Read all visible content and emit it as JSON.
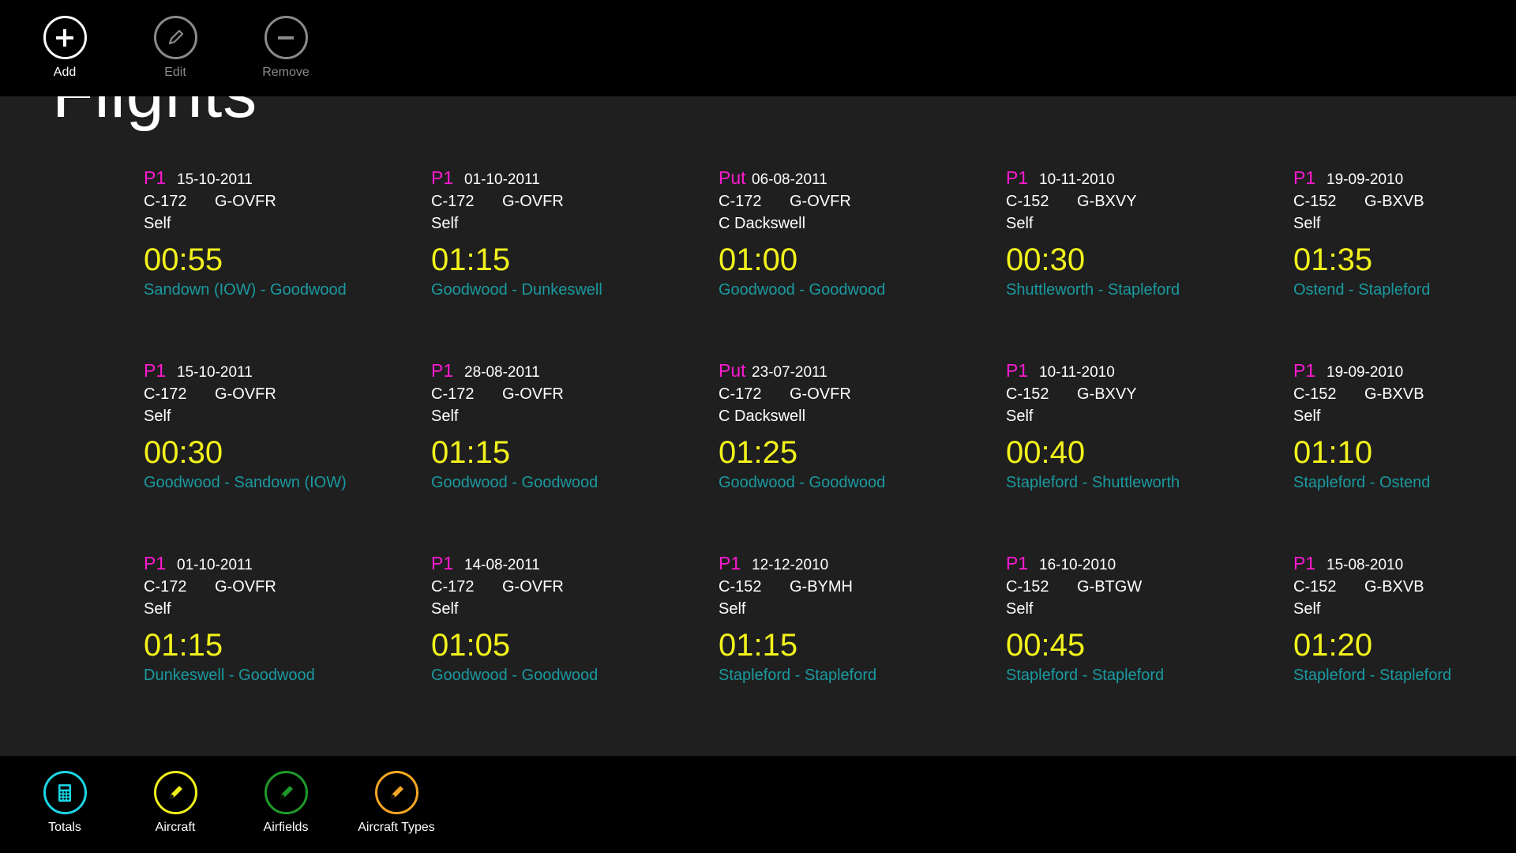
{
  "page": {
    "title": "Flights"
  },
  "top_bar": {
    "buttons": [
      {
        "label": "Add",
        "icon": "plus-icon",
        "enabled": true
      },
      {
        "label": "Edit",
        "icon": "pencil-icon",
        "enabled": false
      },
      {
        "label": "Remove",
        "icon": "minus-icon",
        "enabled": false
      }
    ]
  },
  "bottom_bar": {
    "buttons": [
      {
        "label": "Totals",
        "icon": "calculator-icon",
        "color": "#1ad6e6"
      },
      {
        "label": "Aircraft",
        "icon": "pencil-icon",
        "color": "#f2f21c"
      },
      {
        "label": "Airfields",
        "icon": "pencil-icon",
        "color": "#1f9a2a"
      },
      {
        "label": "Aircraft Types",
        "icon": "pencil-icon",
        "color": "#f5a623"
      }
    ]
  },
  "colors": {
    "role": "#ff1ad0",
    "duration": "#f2f21c",
    "route": "#1a9aa0",
    "background": "#1f1f1f",
    "appbar": "#000000"
  },
  "flights": [
    {
      "role": "P1",
      "date": "15-10-2011",
      "type": "C-172",
      "reg": "G-OVFR",
      "pic": "Self",
      "duration": "00:55",
      "route": "Sandown (IOW) - Goodwood"
    },
    {
      "role": "P1",
      "date": "01-10-2011",
      "type": "C-172",
      "reg": "G-OVFR",
      "pic": "Self",
      "duration": "01:15",
      "route": "Goodwood - Dunkeswell"
    },
    {
      "role": "Put",
      "date": "06-08-2011",
      "type": "C-172",
      "reg": "G-OVFR",
      "pic": "C Dackswell",
      "duration": "01:00",
      "route": "Goodwood - Goodwood"
    },
    {
      "role": "P1",
      "date": "10-11-2010",
      "type": "C-152",
      "reg": "G-BXVY",
      "pic": "Self",
      "duration": "00:30",
      "route": "Shuttleworth - Stapleford"
    },
    {
      "role": "P1",
      "date": "19-09-2010",
      "type": "C-152",
      "reg": "G-BXVB",
      "pic": "Self",
      "duration": "01:35",
      "route": "Ostend - Stapleford"
    },
    {
      "role": "P1",
      "date": "15-10-2011",
      "type": "C-172",
      "reg": "G-OVFR",
      "pic": "Self",
      "duration": "00:30",
      "route": "Goodwood - Sandown (IOW)"
    },
    {
      "role": "P1",
      "date": "28-08-2011",
      "type": "C-172",
      "reg": "G-OVFR",
      "pic": "Self",
      "duration": "01:15",
      "route": "Goodwood - Goodwood"
    },
    {
      "role": "Put",
      "date": "23-07-2011",
      "type": "C-172",
      "reg": "G-OVFR",
      "pic": "C Dackswell",
      "duration": "01:25",
      "route": "Goodwood - Goodwood"
    },
    {
      "role": "P1",
      "date": "10-11-2010",
      "type": "C-152",
      "reg": "G-BXVY",
      "pic": "Self",
      "duration": "00:40",
      "route": "Stapleford - Shuttleworth"
    },
    {
      "role": "P1",
      "date": "19-09-2010",
      "type": "C-152",
      "reg": "G-BXVB",
      "pic": "Self",
      "duration": "01:10",
      "route": "Stapleford - Ostend"
    },
    {
      "role": "P1",
      "date": "01-10-2011",
      "type": "C-172",
      "reg": "G-OVFR",
      "pic": "Self",
      "duration": "01:15",
      "route": "Dunkeswell - Goodwood"
    },
    {
      "role": "P1",
      "date": "14-08-2011",
      "type": "C-172",
      "reg": "G-OVFR",
      "pic": "Self",
      "duration": "01:05",
      "route": "Goodwood - Goodwood"
    },
    {
      "role": "P1",
      "date": "12-12-2010",
      "type": "C-152",
      "reg": "G-BYMH",
      "pic": "Self",
      "duration": "01:15",
      "route": "Stapleford - Stapleford"
    },
    {
      "role": "P1",
      "date": "16-10-2010",
      "type": "C-152",
      "reg": "G-BTGW",
      "pic": "Self",
      "duration": "00:45",
      "route": "Stapleford - Stapleford"
    },
    {
      "role": "P1",
      "date": "15-08-2010",
      "type": "C-152",
      "reg": "G-BXVB",
      "pic": "Self",
      "duration": "01:20",
      "route": "Stapleford - Stapleford"
    }
  ]
}
